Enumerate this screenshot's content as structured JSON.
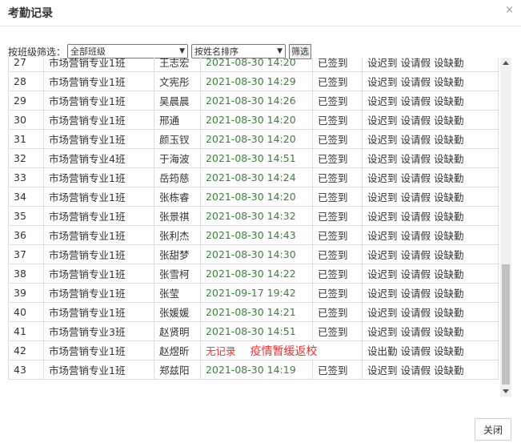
{
  "dialog": {
    "title": "考勤记录",
    "close_icon": "×",
    "close_button": "关闭"
  },
  "filter": {
    "label": "按班级筛选：",
    "class_select": "全部班级",
    "sort_select": "按姓名排序",
    "filter_button": "筛选"
  },
  "actions": {
    "late": "设迟到",
    "leave": "设请假",
    "absent": "设缺勤",
    "out": "设出勤"
  },
  "rows": [
    {
      "idx": "27",
      "cls": "市场营销专业1班",
      "name": "王志宏",
      "time": "2021-08-30 14:20",
      "status": "已签到"
    },
    {
      "idx": "28",
      "cls": "市场营销专业1班",
      "name": "文宪彤",
      "time": "2021-08-30 14:29",
      "status": "已签到"
    },
    {
      "idx": "29",
      "cls": "市场营销专业1班",
      "name": "吴晨晨",
      "time": "2021-08-30 14:26",
      "status": "已签到"
    },
    {
      "idx": "30",
      "cls": "市场营销专业1班",
      "name": "邢通",
      "time": "2021-08-30 14:20",
      "status": "已签到"
    },
    {
      "idx": "31",
      "cls": "市场营销专业1班",
      "name": "颜玉钗",
      "time": "2021-08-30 14:20",
      "status": "已签到"
    },
    {
      "idx": "32",
      "cls": "市场营销专业4班",
      "name": "于海波",
      "time": "2021-08-30 14:51",
      "status": "已签到"
    },
    {
      "idx": "33",
      "cls": "市场营销专业1班",
      "name": "岳筠慈",
      "time": "2021-08-30 14:24",
      "status": "已签到"
    },
    {
      "idx": "34",
      "cls": "市场营销专业1班",
      "name": "张栋睿",
      "time": "2021-08-30 14:20",
      "status": "已签到"
    },
    {
      "idx": "35",
      "cls": "市场营销专业1班",
      "name": "张景祺",
      "time": "2021-08-30 14:32",
      "status": "已签到"
    },
    {
      "idx": "36",
      "cls": "市场营销专业1班",
      "name": "张利杰",
      "time": "2021-08-30 14:43",
      "status": "已签到"
    },
    {
      "idx": "37",
      "cls": "市场营销专业1班",
      "name": "张甜梦",
      "time": "2021-08-30 14:30",
      "status": "已签到"
    },
    {
      "idx": "38",
      "cls": "市场营销专业1班",
      "name": "张雪柯",
      "time": "2021-08-30 14:22",
      "status": "已签到"
    },
    {
      "idx": "39",
      "cls": "市场营销专业1班",
      "name": "张莹",
      "time": "2021-09-17 19:42",
      "status": "已签到"
    },
    {
      "idx": "40",
      "cls": "市场营销专业1班",
      "name": "张媛媛",
      "time": "2021-08-30 14:21",
      "status": "已签到"
    },
    {
      "idx": "41",
      "cls": "市场营销专业3班",
      "name": "赵贤明",
      "time": "2021-08-30 14:51",
      "status": "已签到"
    }
  ],
  "row42": {
    "idx": "42",
    "cls": "市场营销专业1班",
    "name": "赵煜昕",
    "no_record": "无记录",
    "note": "疫情暂缓返校"
  },
  "row43": {
    "idx": "43",
    "cls": "市场营销专业1班",
    "name": "郑兹阳",
    "time": "2021-08-30 14:19",
    "status": "已签到"
  },
  "colors": {
    "time": "#2e8b2e",
    "alert": "#ff2a2a"
  }
}
